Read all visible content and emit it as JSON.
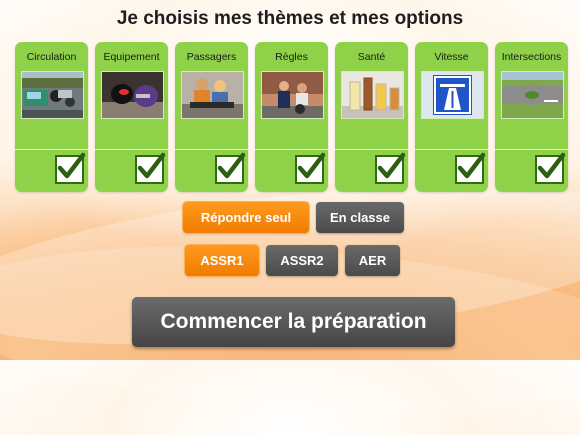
{
  "title": "Je choisis mes thèmes et mes options",
  "themes": [
    {
      "label": "Circulation",
      "icon": "traffic-photo",
      "checked": true
    },
    {
      "label": "Equipement",
      "icon": "helmet-photo",
      "checked": true
    },
    {
      "label": "Passagers",
      "icon": "passengers-photo",
      "checked": true
    },
    {
      "label": "Règles",
      "icon": "police-photo",
      "checked": true
    },
    {
      "label": "Santé",
      "icon": "drinks-photo",
      "checked": true
    },
    {
      "label": "Vitesse",
      "icon": "highway-sign-photo",
      "checked": true
    },
    {
      "label": "Intersections",
      "icon": "roundabout-photo",
      "checked": true
    }
  ],
  "mode": {
    "solo_label": "Répondre seul",
    "class_label": "En classe",
    "selected": "solo"
  },
  "level": {
    "assr1_label": "ASSR1",
    "assr2_label": "ASSR2",
    "aer_label": "AER",
    "selected": "assr1"
  },
  "start_button_label": "Commencer la préparation",
  "colors": {
    "tile_green": "#8fd24a",
    "check_green": "#2f6a16",
    "selected_orange": "#f07c00",
    "unselected_gray": "#555555"
  }
}
